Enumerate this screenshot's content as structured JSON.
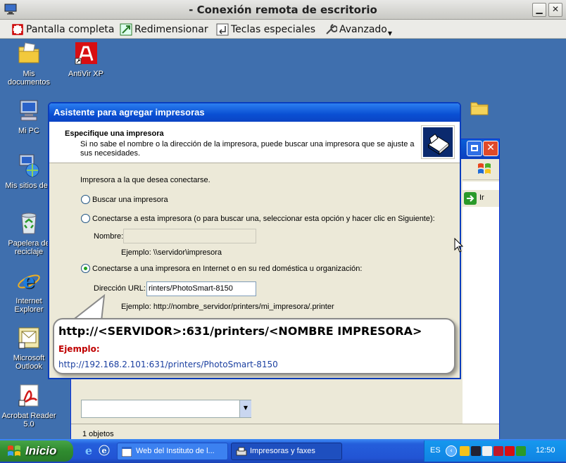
{
  "remote_window": {
    "title": "- Conexión remota de escritorio",
    "minimize_glyph": "▁",
    "close_glyph": "✕"
  },
  "toolbar": {
    "fullscreen_label": "Pantalla completa",
    "resize_label": "Redimensionar",
    "special_keys_label": "Teclas especiales",
    "advanced_label": "Avanzado"
  },
  "desktop_icons": [
    {
      "label": "Mis documentos",
      "icon": "folder-icon"
    },
    {
      "label": "AntiVir XP",
      "icon": "antivir-icon"
    },
    {
      "label": "Mi PC",
      "icon": "computer-icon"
    },
    {
      "label": "Mis sitios de r",
      "icon": "network-icon"
    },
    {
      "label": "Papelera de reciclaje",
      "icon": "recycle-bin-icon"
    },
    {
      "label": "Internet Explorer",
      "icon": "ie-icon"
    },
    {
      "label": "Microsoft Outlook",
      "icon": "outlook-icon"
    },
    {
      "label": "Acrobat Reader 5.0",
      "icon": "acrobat-icon"
    }
  ],
  "explorer": {
    "go_label": "Ir",
    "status": "1 objetos"
  },
  "wizard": {
    "title": "Asistente para agregar impresoras",
    "header_title": "Especifique una impresora",
    "header_subtitle": "Si no sabe el nombre o la dirección de la impresora, puede buscar una impresora que se ajuste a sus necesidades.",
    "prompt": "Impresora a la que desea conectarse.",
    "option_browse": "Buscar una impresora",
    "option_connect": "Conectarse a esta impresora (o para buscar una, seleccionar esta opción y hacer clic en Siguiente):",
    "name_label": "Nombre:",
    "name_value": "",
    "name_example": "Ejemplo: \\\\servidor\\impresora",
    "option_internet": "Conectarse a una impresora en Internet o en su red doméstica u organización:",
    "url_label": "Dirección URL:",
    "url_value": "rinters/PhotoSmart-8150",
    "url_example": "Ejemplo: http://nombre_servidor/printers/mi_impresora/.printer",
    "selected_option": "internet"
  },
  "callout": {
    "main": "http://<SERVIDOR>:631/printers/<NOMBRE IMPRESORA>",
    "example_label": "Ejemplo:",
    "example_url": "http://192.168.2.101:631/printers/PhotoSmart-8150"
  },
  "taskbar": {
    "start_label": "Inicio",
    "tasks": [
      {
        "label": "Web del Instituto de l..."
      },
      {
        "label": "Impresoras y faxes"
      }
    ],
    "language": "ES",
    "clock": "12:50"
  },
  "colors": {
    "desktop": "#3f6fae",
    "xp_title_blue": "#0a4fd3",
    "callout_red": "#c00000"
  }
}
